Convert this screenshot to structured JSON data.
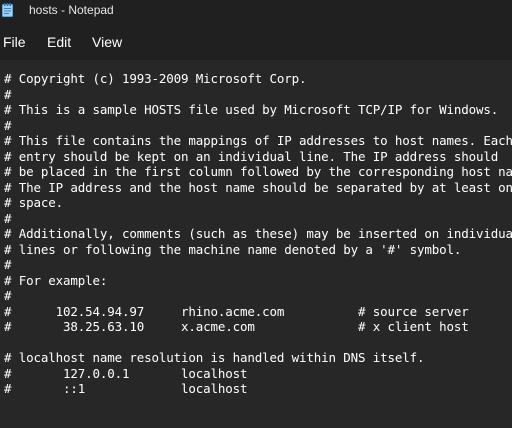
{
  "window": {
    "title": "hosts - Notepad",
    "icon": "notepad-icon"
  },
  "menubar": {
    "file_label": "File",
    "edit_label": "Edit",
    "view_label": "View"
  },
  "editor": {
    "content": "# Copyright (c) 1993-2009 Microsoft Corp.\n#\n# This is a sample HOSTS file used by Microsoft TCP/IP for Windows.\n#\n# This file contains the mappings of IP addresses to host names. Each\n# entry should be kept on an individual line. The IP address should\n# be placed in the first column followed by the corresponding host name.\n# The IP address and the host name should be separated by at least one\n# space.\n#\n# Additionally, comments (such as these) may be inserted on individual\n# lines or following the machine name denoted by a '#' symbol.\n#\n# For example:\n#\n#      102.54.94.97     rhino.acme.com          # source server\n#       38.25.63.10     x.acme.com              # x client host\n\n# localhost name resolution is handled within DNS itself.\n#\t127.0.0.1       localhost\n#\t::1             localhost"
  },
  "colors": {
    "background": "#272727",
    "chrome": "#202020",
    "text": "#ffffff"
  }
}
